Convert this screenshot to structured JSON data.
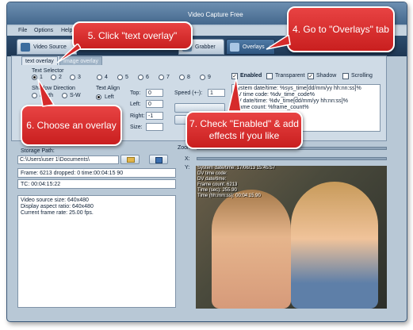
{
  "window": {
    "title": "Video Capture Free"
  },
  "menu": {
    "items": [
      "File",
      "Options",
      "Help"
    ]
  },
  "tabs": [
    {
      "label": "Video Source"
    },
    {
      "label": "Grabber"
    },
    {
      "label": "Overlays"
    }
  ],
  "subtabs": {
    "text_overlay": "text overlay",
    "image_overlay": "Image overlay"
  },
  "text_selector": {
    "label": "Text Selector",
    "options": [
      "1",
      "2",
      "3",
      "4",
      "5",
      "6",
      "7",
      "8",
      "9"
    ]
  },
  "shadow_direction": {
    "label": "Shadow Direction",
    "options": [
      "North",
      "S-W"
    ]
  },
  "text_align": {
    "label": "Text Align",
    "options": [
      "Left"
    ]
  },
  "position": {
    "top_label": "Top:",
    "top_value": "0",
    "left_label": "Left:",
    "left_value": "0",
    "right_label": "Right:",
    "right_value": "-1",
    "size_label": "Size:"
  },
  "speed": {
    "label": "Speed (+-):",
    "value": "1"
  },
  "effects": {
    "enabled": "Enabled",
    "transparent": "Transparent",
    "shadow": "Shadow",
    "scrolling": "Scrolling"
  },
  "overlay_text": [
    "System date/time: %sys_time[dd/mm/yy hh:nn:ss]%",
    "DV time code: %dv_time_code%",
    "DV date/time: %dv_time[dd/mm/yy hh:nn:ss]%",
    "Frame count: %frame_count%"
  ],
  "storage": {
    "label": "Storage Path:",
    "path": "C:\\Users\\user 1\\Documents\\"
  },
  "status": {
    "frame_line": "Frame: 6213 dropped: 0 time:00:04:15 90",
    "tc_line": "TC: 00:04:15:22",
    "source_lines": [
      "Video source size: 640x480",
      "Display aspect ratio: 640x480",
      "Current frame rate: 25.00 fps."
    ]
  },
  "zoom": {
    "zoom_label": "Zoom:",
    "x_label": "X:",
    "y_label": "Y:"
  },
  "video_osd": [
    "System date/time: 17/06/13 15:45:57",
    "DV time code:",
    "DV date/time:",
    "Frame count: 6213",
    "Time (sec): 255.90",
    "Time (hh:mm:ss): 00:04:15.90"
  ],
  "callouts": {
    "c4": "4. Go to \"Overlays\" tab",
    "c5": "5. Click \"text overlay\"",
    "c6": "6. Choose an overlay",
    "c7": "7. Check \"Enabled\" & add effects if you like"
  },
  "colors": {
    "callout": "#d62b2b",
    "titlebar": "#4d7195",
    "window_bg": "#b8c8d6"
  }
}
